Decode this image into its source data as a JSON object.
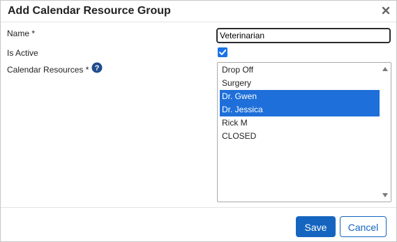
{
  "dialog": {
    "title": "Add Calendar Resource Group",
    "close_icon": "close-icon"
  },
  "form": {
    "name_label": "Name *",
    "name_value": "Veterinarian",
    "active_label": "Is Active",
    "active_checked": true,
    "resources_label": "Calendar Resources *",
    "help_icon": "help-icon",
    "resources": [
      {
        "label": "Drop Off",
        "selected": false
      },
      {
        "label": "Surgery",
        "selected": false
      },
      {
        "label": "Dr. Gwen",
        "selected": true
      },
      {
        "label": "Dr. Jessica",
        "selected": true
      },
      {
        "label": "Rick M",
        "selected": false
      },
      {
        "label": "CLOSED",
        "selected": false
      }
    ]
  },
  "footer": {
    "save_label": "Save",
    "cancel_label": "Cancel"
  },
  "colors": {
    "accent": "#1565c0",
    "selection": "#1e6fd9",
    "checkbox": "#1a73e8"
  }
}
